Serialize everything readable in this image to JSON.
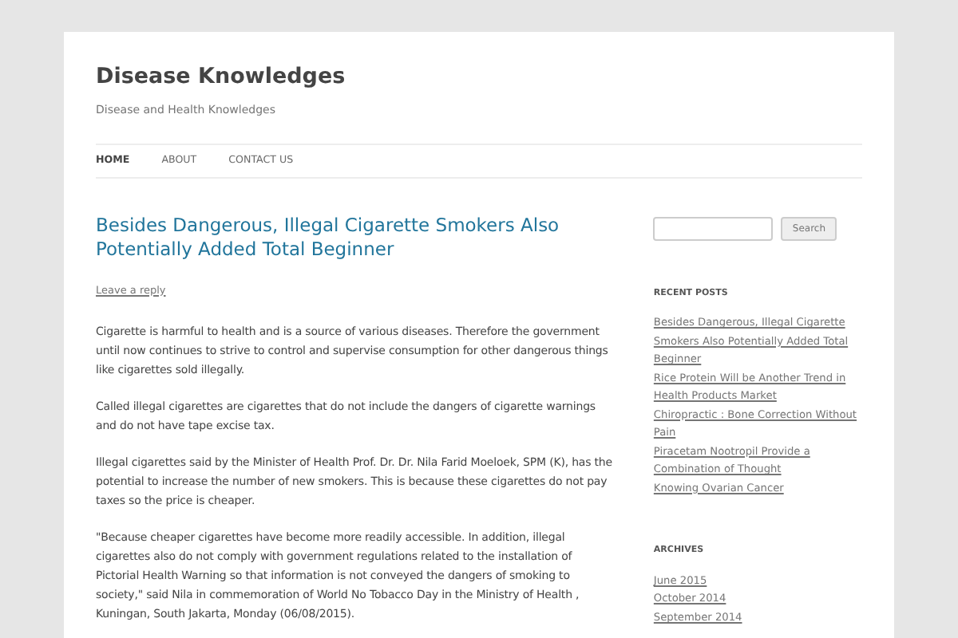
{
  "site": {
    "title": "Disease Knowledges",
    "tagline": "Disease and Health Knowledges"
  },
  "nav": [
    {
      "label": "HOME",
      "selected": true
    },
    {
      "label": "ABOUT",
      "selected": false
    },
    {
      "label": "CONTACT US",
      "selected": false
    }
  ],
  "post": {
    "title": "Besides Dangerous, Illegal Cigarette Smokers Also Potentially Added Total Beginner",
    "reply_link": "Leave a reply",
    "paragraphs": [
      "Cigarette is harmful to health and is a source of various diseases. Therefore the government until now continues to strive to control and supervise consumption for other dangerous things like cigarettes sold illegally.",
      "Called illegal cigarettes are cigarettes that do not include the dangers of cigarette warnings and do not have tape excise tax.",
      "Illegal cigarettes said by the Minister of Health Prof. Dr. Dr. Nila Farid Moeloek, SPM (K), has the potential to increase the number of new smokers. This is because these cigarettes do not pay taxes so the price is cheaper.",
      "\"Because cheaper cigarettes have become more readily accessible. In addition, illegal cigarettes also do not comply with government regulations related to the installation of Pictorial Health Warning so that information is not conveyed the dangers of smoking to society,\" said Nila in commemoration of World No Tobacco Day in the Ministry of Health , Kuningan, South Jakarta, Monday (06/08/2015)."
    ]
  },
  "sidebar": {
    "search_button": "Search",
    "widgets": [
      {
        "title": "RECENT POSTS",
        "links": [
          "Besides Dangerous, Illegal Cigarette Smokers Also Potentially Added Total Beginner",
          "Rice Protein Will be Another Trend in Health Products Market",
          "Chiropractic : Bone Correction Without Pain",
          "Piracetam Nootropil Provide a Combination of Thought",
          "Knowing Ovarian Cancer"
        ]
      },
      {
        "title": "ARCHIVES",
        "links": [
          "June 2015",
          "October 2014",
          "September 2014"
        ]
      }
    ]
  }
}
